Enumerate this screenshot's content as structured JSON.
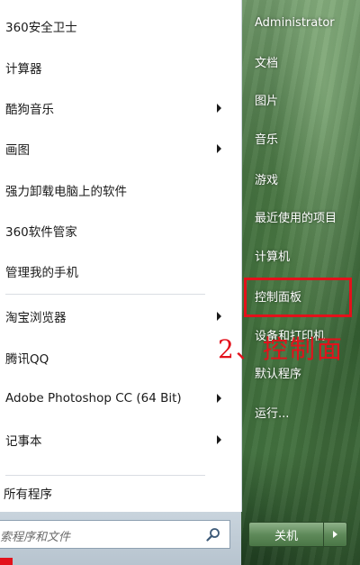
{
  "left_menu": {
    "items": [
      {
        "label": "360安全卫士",
        "has_arrow": false
      },
      {
        "label": "计算器",
        "has_arrow": false
      },
      {
        "label": "酷狗音乐",
        "has_arrow": true
      },
      {
        "label": "画图",
        "has_arrow": true
      },
      {
        "label": "强力卸载电脑上的软件",
        "has_arrow": false
      },
      {
        "label": "360软件管家",
        "has_arrow": false
      },
      {
        "label": "管理我的手机",
        "has_arrow": false
      },
      {
        "label": "淘宝浏览器",
        "has_arrow": true
      },
      {
        "label": "腾讯QQ",
        "has_arrow": false
      },
      {
        "label": "Adobe Photoshop CC (64 Bit)",
        "has_arrow": true
      },
      {
        "label": "记事本",
        "has_arrow": true
      }
    ],
    "all_programs": "所有程序",
    "search_placeholder": "索程序和文件"
  },
  "right_menu": {
    "items": [
      "Administrator",
      "文档",
      "图片",
      "音乐",
      "游戏",
      "最近使用的项目",
      "计算机",
      "控制面板",
      "设备和打印机",
      "默认程序",
      "运行..."
    ]
  },
  "shutdown": {
    "label": "关机"
  },
  "annotation": {
    "text": "2、控制面"
  },
  "colors": {
    "highlight": "#e3111b",
    "panel_bg": "#ffffff",
    "right_bg": "#3f6a3b"
  },
  "icons": [
    "search-icon",
    "chevron-right-icon"
  ]
}
